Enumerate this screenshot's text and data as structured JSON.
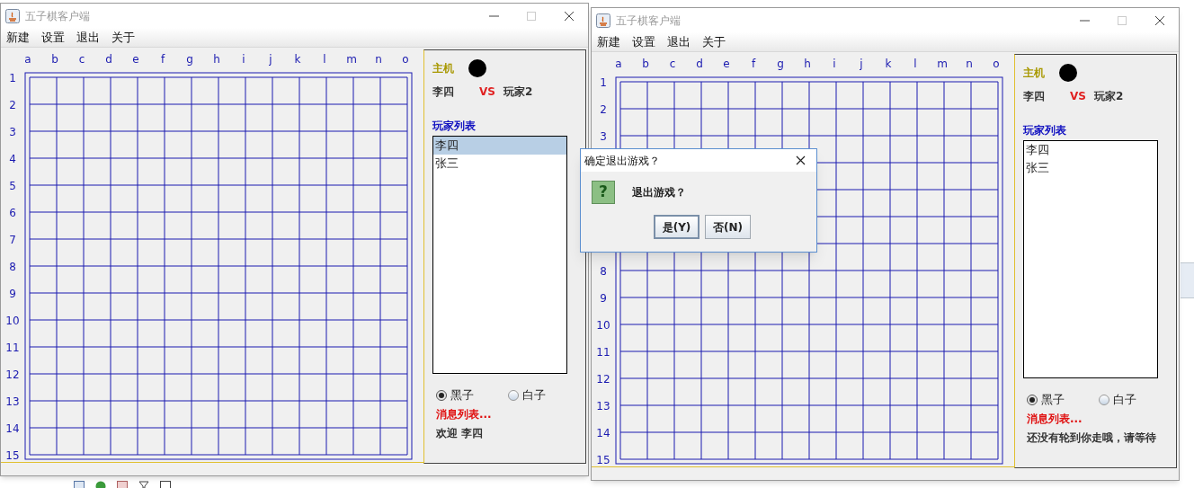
{
  "windows": [
    {
      "title": "五子棋客户端",
      "menu": [
        "新建",
        "设置",
        "退出",
        "关于"
      ],
      "board": {
        "columns": [
          "a",
          "b",
          "c",
          "d",
          "e",
          "f",
          "g",
          "h",
          "i",
          "j",
          "k",
          "l",
          "m",
          "n",
          "o"
        ],
        "rows": [
          "1",
          "2",
          "3",
          "4",
          "5",
          "6",
          "7",
          "8",
          "9",
          "10",
          "11",
          "12",
          "13",
          "14",
          "15"
        ]
      },
      "panel": {
        "host_label": "主机",
        "player_one": "李四",
        "versus": "VS",
        "player_two": "玩家2",
        "list_title": "玩家列表",
        "players": [
          {
            "name": "李四",
            "selected": true
          },
          {
            "name": "张三",
            "selected": false
          }
        ],
        "stone_options": [
          {
            "label": "黑子",
            "selected": true
          },
          {
            "label": "白子",
            "selected": false
          }
        ],
        "messages_title": "消息列表...",
        "message": "欢迎 李四"
      }
    },
    {
      "title": "五子棋客户端",
      "menu": [
        "新建",
        "设置",
        "退出",
        "关于"
      ],
      "board": {
        "columns": [
          "a",
          "b",
          "c",
          "d",
          "e",
          "f",
          "g",
          "h",
          "i",
          "j",
          "k",
          "l",
          "m",
          "n",
          "o"
        ],
        "rows": [
          "1",
          "2",
          "3",
          null,
          null,
          null,
          null,
          "8",
          "9",
          "10",
          "11",
          "12",
          "13",
          "14",
          "15"
        ]
      },
      "panel": {
        "host_label": "主机",
        "player_one": "李四",
        "versus": "VS",
        "player_two": "玩家2",
        "list_title": "玩家列表",
        "players": [
          {
            "name": "李四",
            "selected": false
          },
          {
            "name": "张三",
            "selected": false
          }
        ],
        "stone_options": [
          {
            "label": "黑子",
            "selected": true
          },
          {
            "label": "白子",
            "selected": false
          }
        ],
        "messages_title": "消息列表...",
        "message": "还没有轮到你走哦，请等待"
      }
    }
  ],
  "dialog": {
    "title": "确定退出游戏？",
    "icon": "?",
    "message": "退出游戏？",
    "buttons": [
      {
        "label": "是(Y)",
        "selected": true
      },
      {
        "label": "否(N)",
        "selected": false
      }
    ]
  }
}
